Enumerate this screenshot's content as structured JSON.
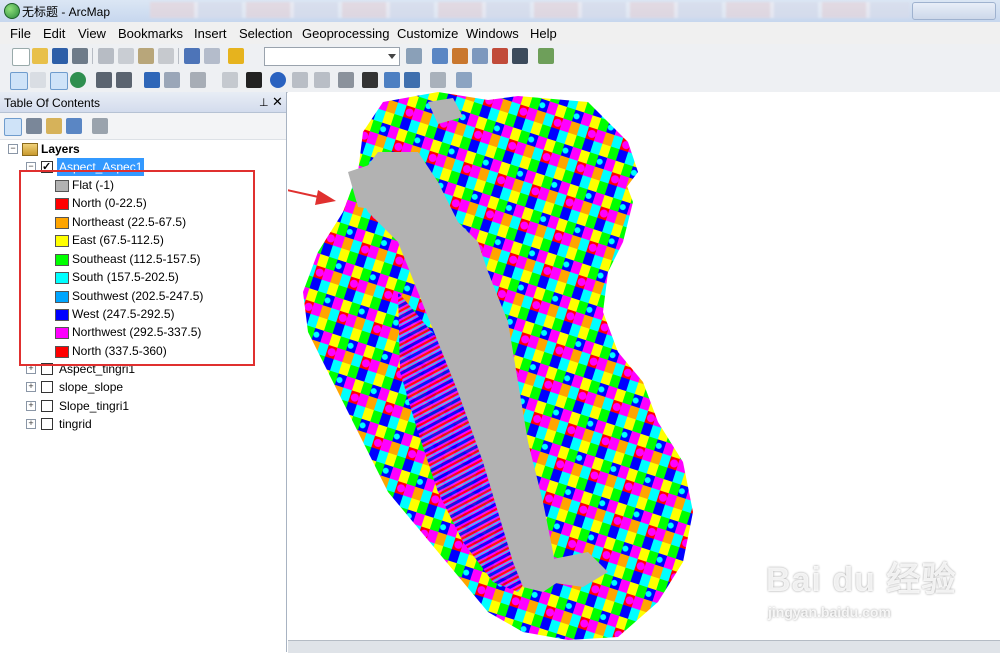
{
  "window": {
    "title": "无标题 - ArcMap"
  },
  "menu": [
    "File",
    "Edit",
    "View",
    "Bookmarks",
    "Insert",
    "Selection",
    "Geoprocessing",
    "Customize",
    "Windows",
    "Help"
  ],
  "toc": {
    "title": "Table Of Contents",
    "pin": "⊥",
    "close": "✕",
    "root": "Layers",
    "active_layer": "Aspect_Aspec1",
    "legend": [
      {
        "label": "Flat (-1)",
        "color": "#b2b2b2"
      },
      {
        "label": "North (0-22.5)",
        "color": "#ff0000"
      },
      {
        "label": "Northeast (22.5-67.5)",
        "color": "#ffa500"
      },
      {
        "label": "East (67.5-112.5)",
        "color": "#ffff00"
      },
      {
        "label": "Southeast (112.5-157.5)",
        "color": "#00ff00"
      },
      {
        "label": "South (157.5-202.5)",
        "color": "#00ffff"
      },
      {
        "label": "Southwest (202.5-247.5)",
        "color": "#00a6ff"
      },
      {
        "label": "West (247.5-292.5)",
        "color": "#0000ff"
      },
      {
        "label": "Northwest (292.5-337.5)",
        "color": "#ff00ff"
      },
      {
        "label": "North (337.5-360)",
        "color": "#ff0000"
      }
    ],
    "other_layers": [
      "Aspect_tingri1",
      "slope_slope",
      "Slope_tingri1",
      "tingrid"
    ]
  },
  "watermark": {
    "main": "Bai du 经验",
    "sub": "jingyan.baidu.com"
  }
}
